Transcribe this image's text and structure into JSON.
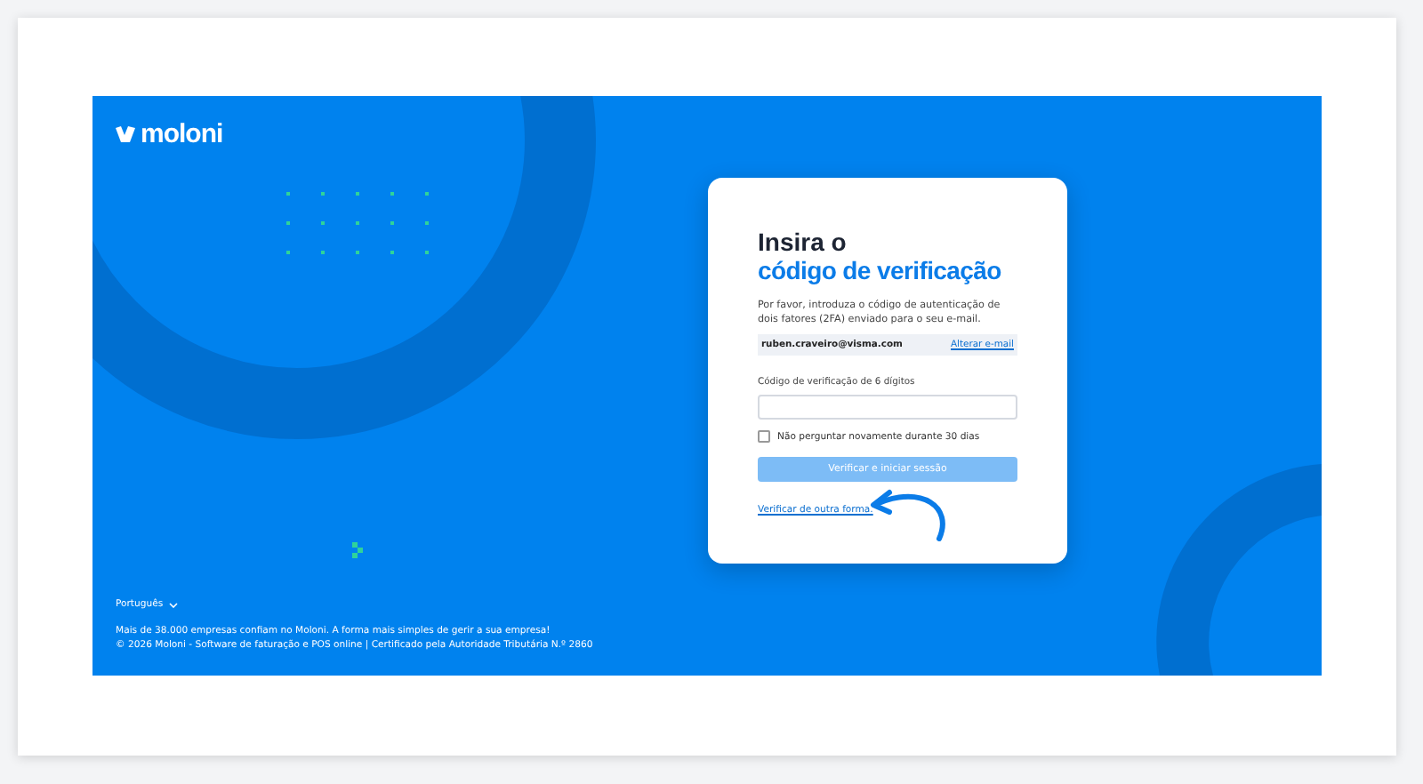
{
  "brand": {
    "name": "moloni"
  },
  "login": {
    "title_line1": "Insira o",
    "title_line2": "código de verificação",
    "description": "Por favor, introduza o código de autenticação de dois fatores (2FA) enviado para o seu e-mail.",
    "email": "ruben.craveiro@visma.com",
    "change_email_link": "Alterar e-mail",
    "code_label": "Código de verificação de 6 dígitos",
    "remember": {
      "label": "Não perguntar novamente durante 30 dias",
      "checked": false
    },
    "submit": {
      "label": "Verificar e iniciar sessão",
      "disabled": true
    },
    "alt_link": "Verificar de outra forma."
  },
  "footer": {
    "language": "Português",
    "tagline": "Mais de 38.000 empresas confiam no Moloni. A forma mais simples de gerir a sua empresa!",
    "copyright": "© 2026 Moloni - Software de faturação e POS online | Certificado pela Autoridade Tributária N.º 2860"
  }
}
